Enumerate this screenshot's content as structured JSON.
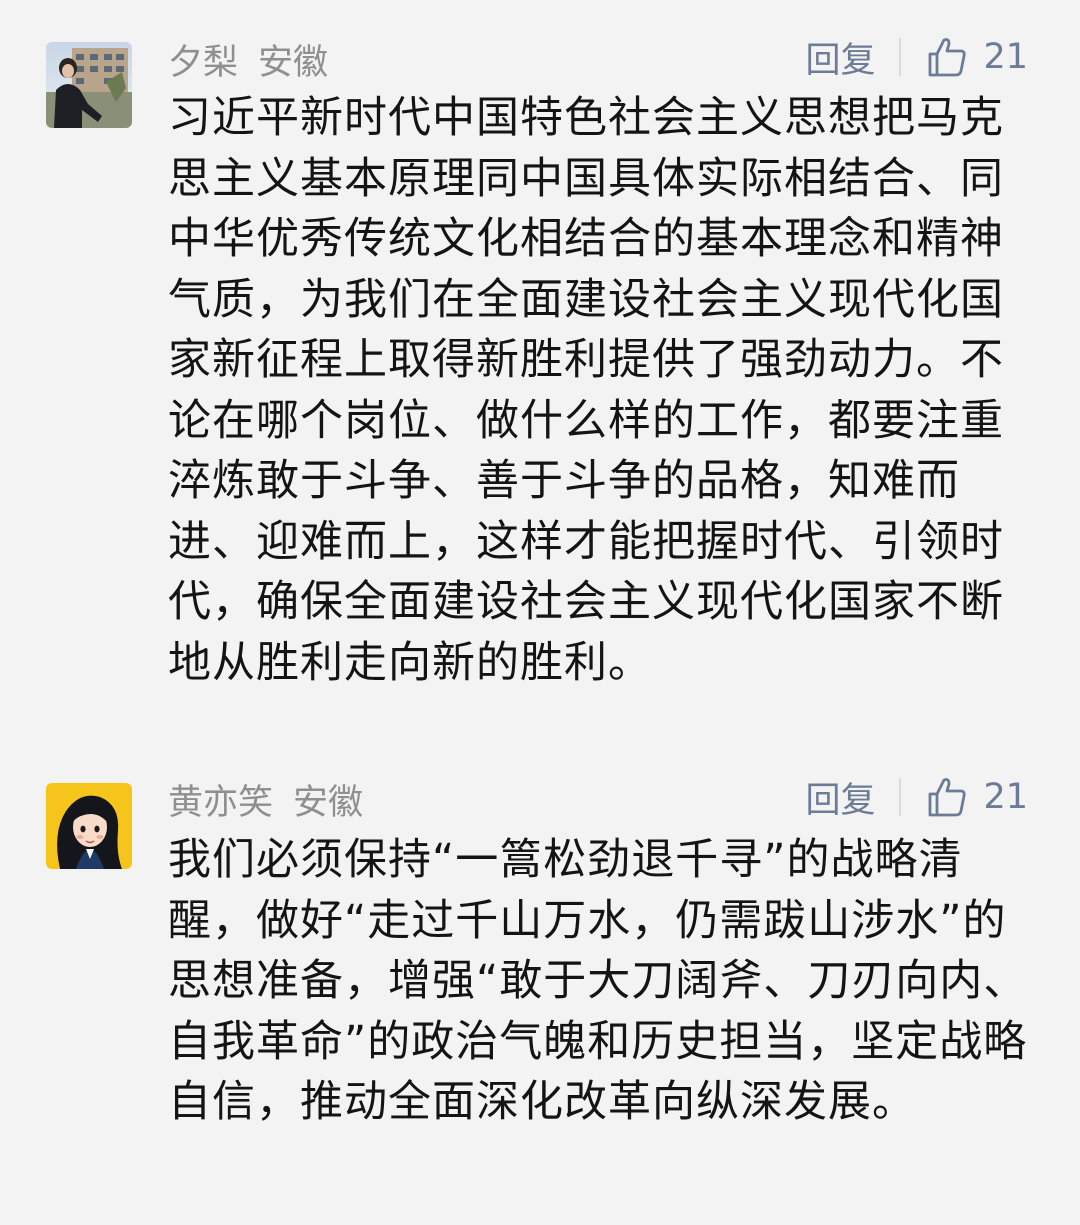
{
  "comments": [
    {
      "name": "夕梨",
      "location": "安徽",
      "reply_label": "回复",
      "like_count": "21",
      "text": "习近平新时代中国特色社会主义思想把马克思主义基本原理同中国具体实际相结合、同中华优秀传统文化相结合的基本理念和精神气质，为我们在全面建设社会主义现代化国家新征程上取得新胜利提供了强劲动力。不论在哪个岗位、做什么样的工作，都要注重淬炼敢于斗争、善于斗争的品格，知难而进、迎难而上，这样才能把握时代、引领时代，确保全面建设社会主义现代化国家不断地从胜利走向新的胜利。",
      "avatar_icon": "user-photo-avatar"
    },
    {
      "name": "黄亦笑",
      "location": "安徽",
      "reply_label": "回复",
      "like_count": "21",
      "text": "我们必须保持“一篙松劲退千寻”的战略清醒，做好“走过千山万水，仍需跋山涉水”的思想准备，增强“敢于大刀阔斧、刀刃向内、自我革命”的政治气魄和历史担当，坚定战略自信，推动全面深化改革向纵深发展。",
      "avatar_icon": "cartoon-girl-avatar"
    }
  ],
  "colors": {
    "background": "#f3f3f3",
    "meta_text": "#8f8f8f",
    "action_text": "#6d7c96",
    "body_text": "#141414"
  },
  "icons": {
    "like": "thumbs-up-icon"
  }
}
